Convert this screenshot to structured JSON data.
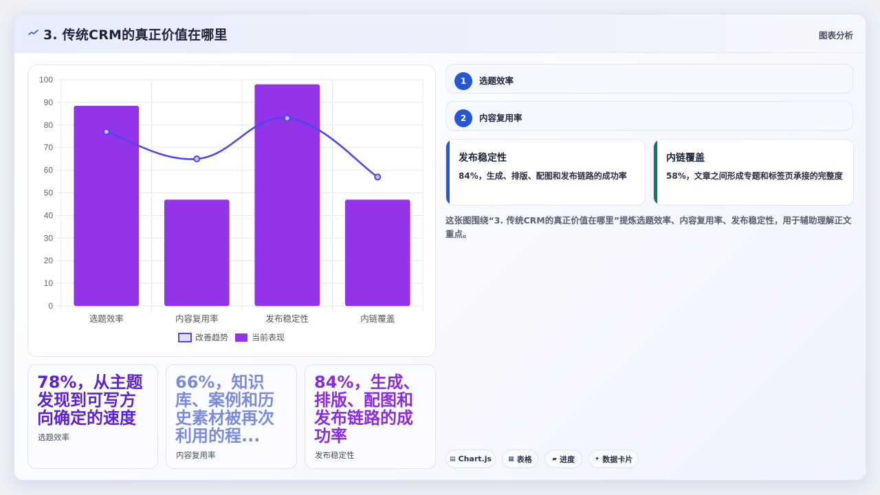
{
  "header": {
    "title": "3. 传统CRM的真正价值在哪里",
    "right_label": "图表分析",
    "icon": "trend-line-icon"
  },
  "chart_data": {
    "type": "bar",
    "categories": [
      "选题效率",
      "内容复用率",
      "发布稳定性",
      "内链覆盖"
    ],
    "series": [
      {
        "name": "当前表现",
        "type": "bar",
        "color": "#9333ea",
        "values": [
          88.5,
          47,
          98,
          47
        ]
      },
      {
        "name": "改善趋势",
        "type": "line",
        "color": "#4f46e5",
        "values": [
          77,
          65,
          83,
          57
        ]
      }
    ],
    "ylim": [
      0,
      100
    ],
    "yticks": [
      0,
      10,
      20,
      30,
      40,
      50,
      60,
      70,
      80,
      90,
      100
    ],
    "grid": true,
    "legend_position": "bottom"
  },
  "legend": [
    "改善趋势",
    "当前表现"
  ],
  "stats": [
    {
      "value": "78%，从主题发现到可写方向确定的速度",
      "label": "选题效率",
      "color": "#5b21d8"
    },
    {
      "value": "66%，知识库、案例和历史素材被再次利用的程...",
      "label": "内容复用率",
      "color": "#7b8bdc"
    },
    {
      "value": "84%，生成、排版、配图和发布链路的成功率",
      "label": "发布稳定性",
      "color": "#8b2be0"
    }
  ],
  "steps": [
    {
      "num": "1",
      "text": "选题效率"
    },
    {
      "num": "2",
      "text": "内容复用率"
    }
  ],
  "metrics": [
    {
      "title": "发布稳定性",
      "desc": "84%，生成、排版、配图和发布链路的成功率",
      "accent": "#2456d6"
    },
    {
      "title": "内链覆盖",
      "desc": "58%，文章之间形成专题和标签页承接的完整度",
      "accent": "#0f766e"
    }
  ],
  "description": "这张图围绕“3. 传统CRM的真正价值在哪里”提炼选题效率、内容复用率、发布稳定性，用于辅助理解正文重点。",
  "tags": [
    {
      "icon": "chart-js-icon",
      "glyph": "▤",
      "label": "Chart.js"
    },
    {
      "icon": "table-icon",
      "glyph": "▦",
      "label": "表格"
    },
    {
      "icon": "progress-icon",
      "glyph": "▰",
      "label": "进度"
    },
    {
      "icon": "data-card-icon",
      "glyph": "✦",
      "label": "数据卡片"
    }
  ]
}
